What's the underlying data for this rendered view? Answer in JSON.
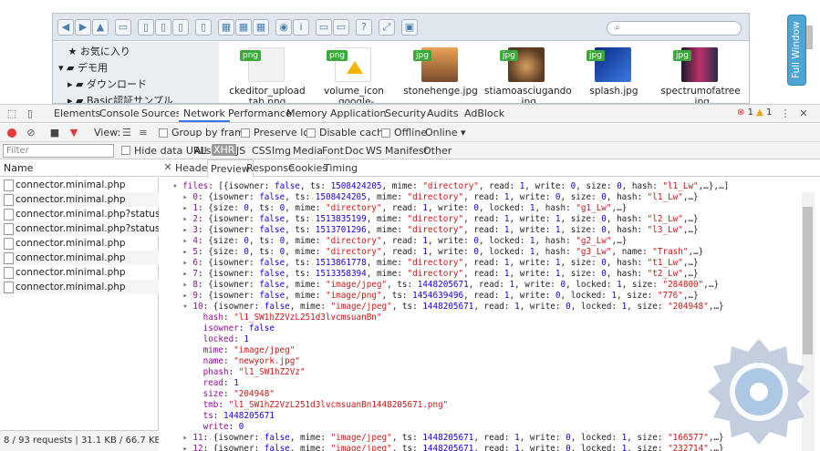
{
  "file_manager": {
    "tree": [
      {
        "label": "お気に入り",
        "arrow": ""
      },
      {
        "label": "デモ用",
        "arrow": "▾"
      },
      {
        "label": "ダウンロード",
        "arrow": "▸"
      },
      {
        "label": "Basic認証サンプル",
        "arrow": "▸"
      }
    ],
    "files": [
      {
        "type": "png",
        "name_line1": "ckeditor_upload",
        "name_line2": "tab.png"
      },
      {
        "type": "png",
        "name_line1": "volume_icon",
        "name_line2": "_google-drive.png"
      },
      {
        "type": "jpg",
        "name_line1": "stonehenge.jpg",
        "name_line2": ""
      },
      {
        "type": "jpg",
        "name_line1": "stiamoasciugando",
        "name_line2": ".jpg"
      },
      {
        "type": "jpg",
        "name_line1": "splash.jpg",
        "name_line2": ""
      },
      {
        "type": "jpg",
        "name_line1": "spectrumofatree",
        "name_line2": ".jpg"
      }
    ],
    "full_window": "Full Window"
  },
  "devtools": {
    "panels": [
      "Elements",
      "Console",
      "Sources",
      "Network",
      "Performance",
      "Memory",
      "Application",
      "Security",
      "Audits",
      "AdBlock"
    ],
    "errors": "1",
    "warnings": "1",
    "view_label": "View:",
    "group_by_frame": "Group by frame",
    "preserve_log": "Preserve log",
    "disable_cache": "Disable cache",
    "offline": "Offline",
    "online": "Online",
    "filter_placeholder": "Filter",
    "hide_data_urls": "Hide data URLs",
    "filter_types": [
      "All",
      "XHR",
      "JS",
      "CSS",
      "Img",
      "Media",
      "Font",
      "Doc",
      "WS",
      "Manifest",
      "Other"
    ],
    "name_header": "Name",
    "requests": [
      "connector.minimal.php",
      "connector.minimal.php",
      "connector.minimal.php?status&_=15...",
      "connector.minimal.php?status&_=15...",
      "connector.minimal.php",
      "connector.minimal.php",
      "connector.minimal.php",
      "connector.minimal.php"
    ],
    "status_bar": "8 / 93 requests  |  31.1 KB / 66.7 KB transf...",
    "detail_tabs": [
      "Headers",
      "Preview",
      "Response",
      "Cookies",
      "Timing"
    ],
    "preview_lines": [
      "▾ files: [{isowner: false, ts: 1508424205, mime: \"directory\", read: 1, write: 0, size: 0, hash: \"l1_Lw\",…},…]",
      "  ▸ 0: {isowner: false, ts: 1508424205, mime: \"directory\", read: 1, write: 0, size: 0, hash: \"l1_Lw\",…}",
      "  ▸ 1: {size: 0, ts: 0, mime: \"directory\", read: 1, write: 0, locked: 1, hash: \"g1_Lw\",…}",
      "  ▸ 2: {isowner: false, ts: 1513835199, mime: \"directory\", read: 1, write: 1, size: 0, hash: \"l2_Lw\",…}",
      "  ▸ 3: {isowner: false, ts: 1513701296, mime: \"directory\", read: 1, write: 1, size: 0, hash: \"l3_Lw\",…}",
      "  ▸ 4: {size: 0, ts: 0, mime: \"directory\", read: 1, write: 0, locked: 1, hash: \"g2_Lw\",…}",
      "  ▸ 5: {size: 0, ts: 0, mime: \"directory\", read: 1, write: 0, locked: 1, hash: \"g3_Lw\", name: \"Trash\",…}",
      "  ▸ 6: {isowner: false, ts: 1513861778, mime: \"directory\", read: 1, write: 1, size: 0, hash: \"t1_Lw\",…}",
      "  ▸ 7: {isowner: false, ts: 1513358394, mime: \"directory\", read: 1, write: 1, size: 0, hash: \"t2_Lw\",…}",
      "  ▸ 8: {isowner: false, mime: \"image/jpeg\", ts: 1448205671, read: 1, write: 0, locked: 1, size: \"284800\",…}",
      "  ▸ 9: {isowner: false, mime: \"image/png\", ts: 1454639496, read: 1, write: 0, locked: 1, size: \"776\",…}",
      "  ▾ 10: {isowner: false, mime: \"image/jpeg\", ts: 1448205671, read: 1, write: 0, locked: 1, size: \"204948\",…}",
      "      hash: \"l1_SW1hZ2VzL251d3lvcmsuanBn\"",
      "      isowner: false",
      "      locked: 1",
      "      mime: \"image/jpeg\"",
      "      name: \"newyork.jpg\"",
      "      phash: \"l1_SW1hZ2Vz\"",
      "      read: 1",
      "      size: \"204948\"",
      "      tmb: \"l1_SW1hZ2VzL251d3lvcmsuanBn1448205671.png\"",
      "      ts: 1448205671",
      "      write: 0",
      "  ▸ 11: {isowner: false, mime: \"image/jpeg\", ts: 1448205671, read: 1, write: 0, locked: 1, size: \"166577\",…}",
      "  ▸ 12: {isowner: false, mime: \"image/jpeg\", ts: 1448205671, read: 1, write: 0, locked: 1, size: \"232714\",…}"
    ]
  },
  "colors": {
    "accent": "#3b78e7",
    "file_tag": "#3aa93a",
    "string": "#c41a16",
    "key": "#881391",
    "number": "#1c00cf"
  }
}
